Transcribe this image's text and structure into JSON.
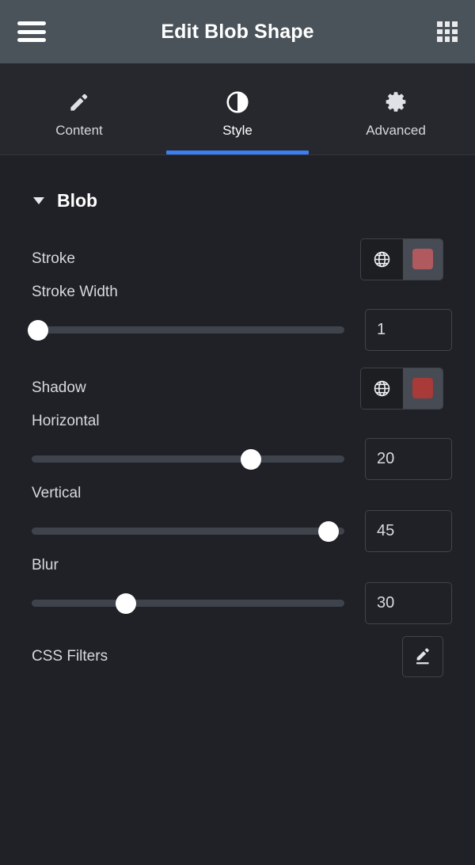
{
  "titlebar": {
    "title": "Edit Blob Shape",
    "menu_icon": "hamburger-menu-icon",
    "apps_icon": "grid-apps-icon"
  },
  "tabs": [
    {
      "label": "Content",
      "icon": "pencil-icon",
      "active": false
    },
    {
      "label": "Style",
      "icon": "contrast-icon",
      "active": true
    },
    {
      "label": "Advanced",
      "icon": "gear-icon",
      "active": false
    }
  ],
  "section": {
    "title": "Blob",
    "expanded": true,
    "caret_icon": "caret-down-icon"
  },
  "controls": {
    "stroke": {
      "label": "Stroke",
      "globe_icon": "globe-icon",
      "swatch_color": "#b05a60"
    },
    "stroke_width": {
      "label": "Stroke Width",
      "value": "1",
      "handle_percent": 2
    },
    "shadow": {
      "label": "Shadow",
      "globe_icon": "globe-icon",
      "swatch_color": "#a83a3a"
    },
    "horizontal": {
      "label": "Horizontal",
      "value": "20",
      "handle_percent": 70
    },
    "vertical": {
      "label": "Vertical",
      "value": "45",
      "handle_percent": 95
    },
    "blur": {
      "label": "Blur",
      "value": "30",
      "handle_percent": 30
    },
    "css_filters": {
      "label": "CSS Filters",
      "edit_icon": "pencil-edit-icon"
    }
  },
  "colors": {
    "header_bg": "#4a525a",
    "tab_bg": "#26282d",
    "panel_bg": "#1f2126",
    "accent": "#3a7ff4",
    "track": "#3f444c",
    "handle": "#ffffff",
    "text": "#d7d9dc"
  }
}
